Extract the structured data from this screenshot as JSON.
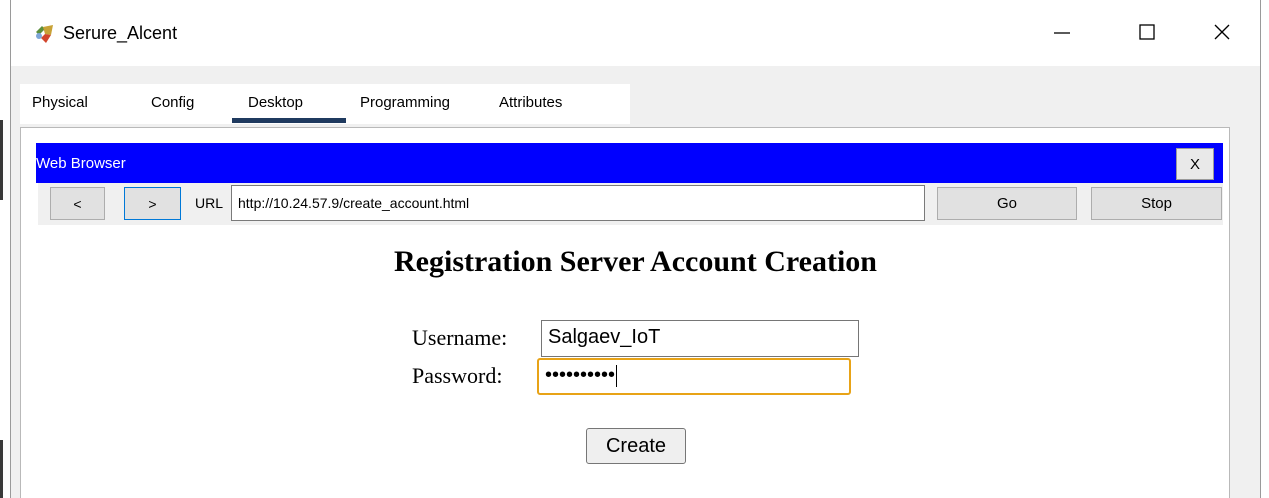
{
  "window": {
    "title": "Serure_Alcent",
    "controls": {
      "minimize": "—",
      "maximize": "☐",
      "close": "✕"
    }
  },
  "tabs": [
    {
      "label": "Physical"
    },
    {
      "label": "Config"
    },
    {
      "label": "Desktop",
      "active": true
    },
    {
      "label": "Programming"
    },
    {
      "label": "Attributes"
    }
  ],
  "web_browser": {
    "title": "Web Browser",
    "close_label": "X",
    "back_label": "<",
    "forward_label": ">",
    "url_label": "URL",
    "url_value": "http://10.24.57.9/create_account.html",
    "go_label": "Go",
    "stop_label": "Stop"
  },
  "page": {
    "heading": "Registration Server Account Creation",
    "username_label": "Username:",
    "username_value": "Salgaev_IoT",
    "password_label": "Password:",
    "password_value": "••••••••••",
    "create_label": "Create"
  },
  "colors": {
    "header_blue": "#0000ff",
    "focus_orange": "#e8a317",
    "active_tab_underline": "#1f3a5f"
  },
  "icons": {
    "app": "packet-tracer-device-icon",
    "minimize": "minimize-icon",
    "maximize": "maximize-icon",
    "close": "close-icon"
  }
}
